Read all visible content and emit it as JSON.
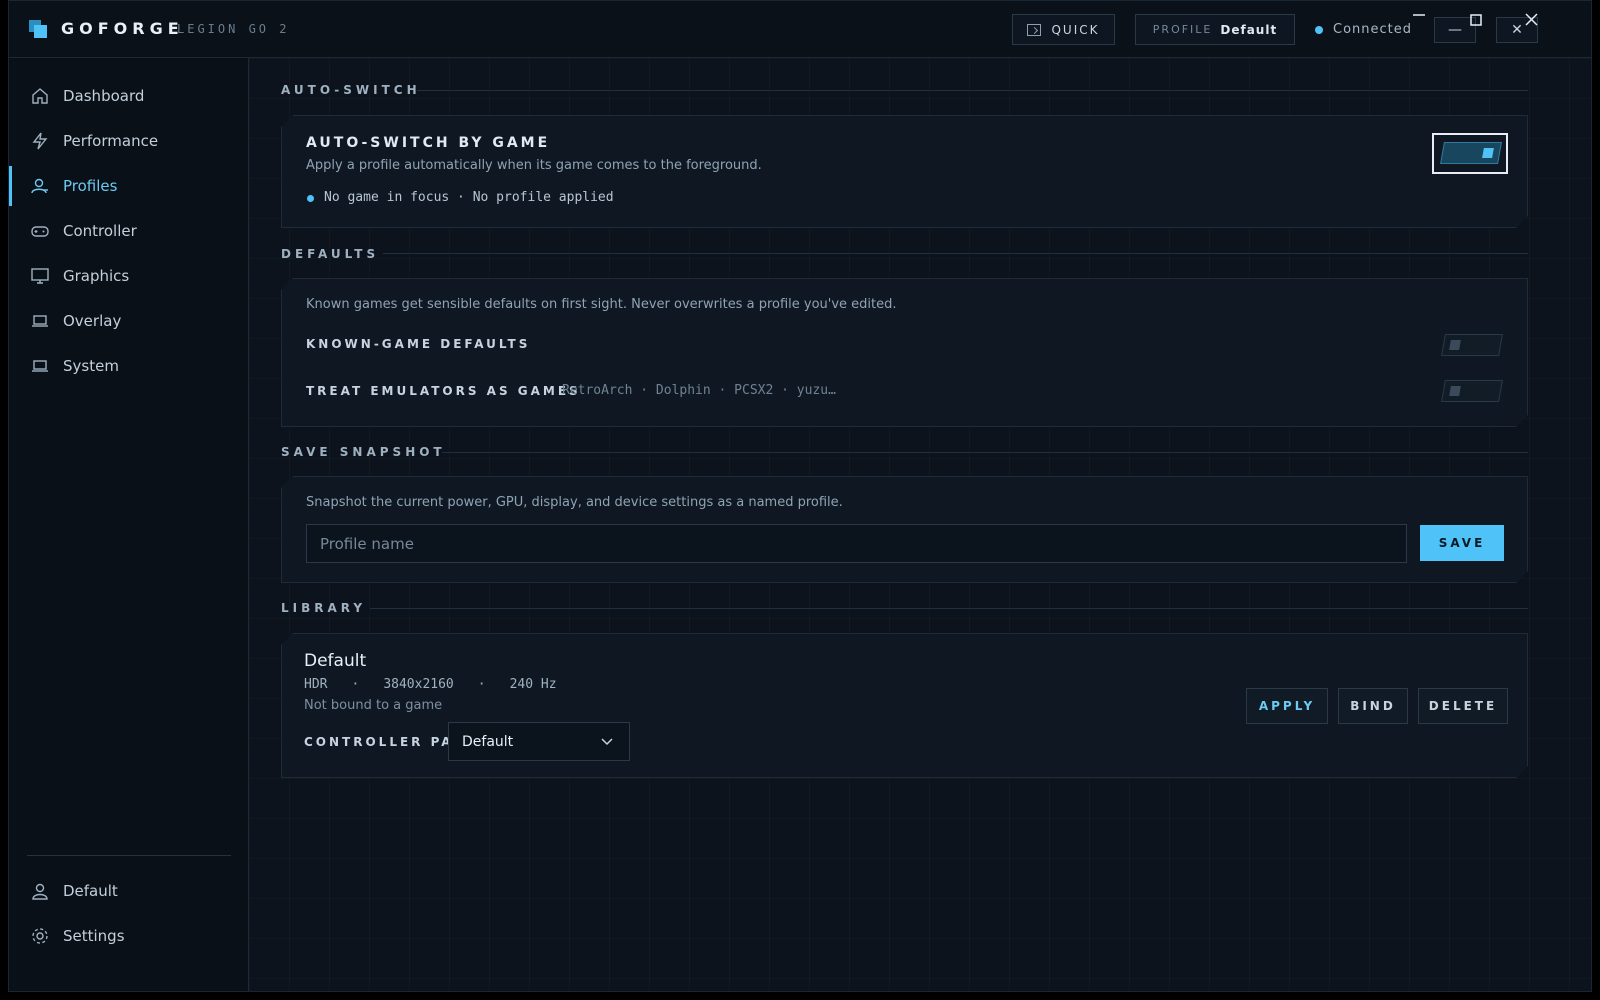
{
  "titlebar": {
    "brand": "GOFORGE",
    "device": "LEGION GO 2",
    "quick_label": "QUICK",
    "profile_label": "PROFILE",
    "profile_value": "Default",
    "connection_status": "Connected",
    "minimize_glyph": "—",
    "close_glyph": "✕"
  },
  "sidebar": {
    "items": [
      {
        "label": "Dashboard",
        "icon": "home-icon"
      },
      {
        "label": "Performance",
        "icon": "bolt-icon"
      },
      {
        "label": "Profiles",
        "icon": "profiles-icon",
        "active": true
      },
      {
        "label": "Controller",
        "icon": "gamepad-icon"
      },
      {
        "label": "Graphics",
        "icon": "monitor-icon"
      },
      {
        "label": "Overlay",
        "icon": "laptop-icon"
      },
      {
        "label": "System",
        "icon": "laptop-icon"
      }
    ],
    "bottom": [
      {
        "label": "Default",
        "icon": "user-icon"
      },
      {
        "label": "Settings",
        "icon": "gear-icon"
      }
    ]
  },
  "auto_switch": {
    "section_title": "AUTO-SWITCH",
    "card_title": "AUTO-SWITCH BY GAME",
    "description": "Apply a profile automatically when its game comes to the foreground.",
    "status": "No game in focus · No profile applied",
    "toggle_on": true
  },
  "defaults": {
    "section_title": "DEFAULTS",
    "description": "Known games get sensible defaults on first sight. Never overwrites a profile you've edited.",
    "known_game_label": "KNOWN-GAME DEFAULTS",
    "known_game_on": false,
    "emulators_label": "TREAT EMULATORS AS GAMES",
    "emulators_list": "RetroArch · Dolphin · PCSX2 · yuzu…",
    "emulators_on": false
  },
  "snapshot": {
    "section_title": "SAVE SNAPSHOT",
    "description": "Snapshot the current power, GPU, display, and device settings as a named profile.",
    "input_placeholder": "Profile name",
    "input_value": "",
    "save_label": "SAVE"
  },
  "library": {
    "section_title": "LIBRARY",
    "profiles": [
      {
        "name": "Default",
        "meta": [
          "HDR",
          "·",
          "3840x2160",
          "·",
          "240 Hz"
        ],
        "binding": "Not bound to a game",
        "pad_label": "CONTROLLER PAD",
        "pad_value": "Default",
        "apply_label": "APPLY",
        "bind_label": "BIND",
        "delete_label": "DELETE"
      }
    ]
  },
  "colors": {
    "accent": "#4fc3f7",
    "background": "#0c131c",
    "card": "#0f1822"
  }
}
